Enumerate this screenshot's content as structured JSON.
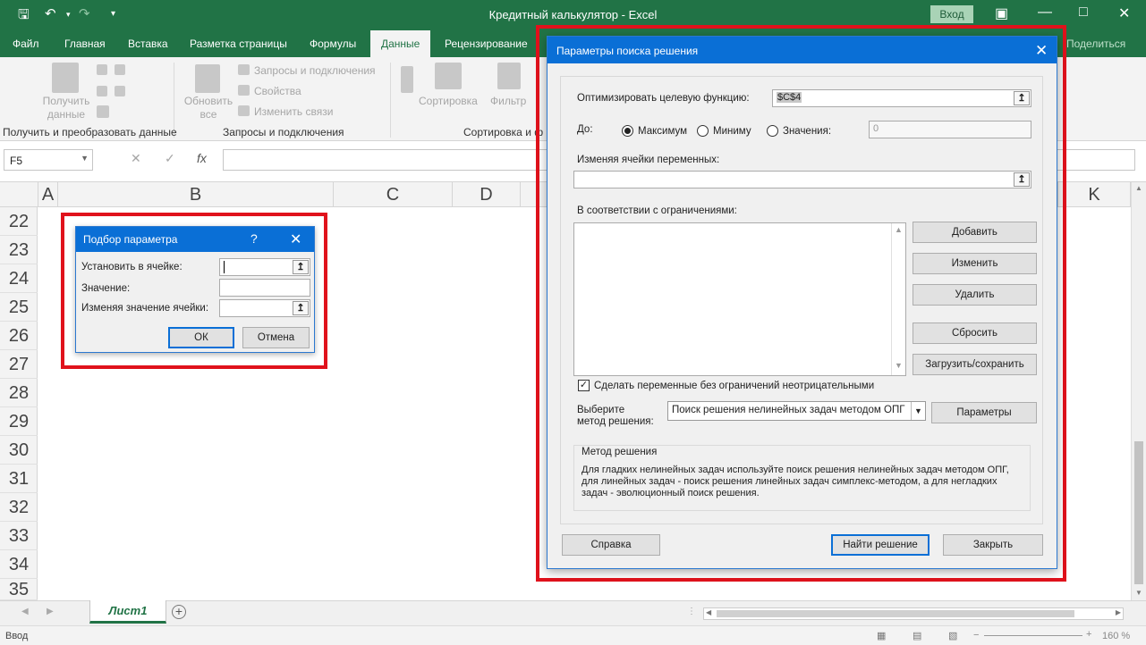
{
  "window": {
    "title": "Кредитный калькулятор  -  Excel",
    "login": "Вход"
  },
  "tabs": [
    "Файл",
    "Главная",
    "Вставка",
    "Разметка страницы",
    "Формулы",
    "Данные",
    "Рецензирование"
  ],
  "active_tab": "Данные",
  "share": "Поделиться",
  "ribbon": {
    "get_data": "Получить данные",
    "refresh": "Обновить все",
    "queries": "Запросы и подключения",
    "properties": "Свойства",
    "edit_links": "Изменить связи",
    "sort": "Сортировка",
    "filter": "Фильтр",
    "group_get": "Получить и преобразовать данные",
    "group_queries": "Запросы и подключения",
    "group_sort": "Сортировка и ф"
  },
  "formula_bar": {
    "name_box": "F5",
    "fx": "fx"
  },
  "columns": [
    "A",
    "B",
    "C",
    "D",
    "K"
  ],
  "rows": [
    "22",
    "23",
    "24",
    "25",
    "26",
    "27",
    "28",
    "29",
    "30",
    "31",
    "32",
    "33",
    "34",
    "35"
  ],
  "sheet": {
    "name": "Лист1"
  },
  "status": {
    "mode": "Ввод",
    "zoom": "160 %"
  },
  "goal_seek": {
    "title": "Подбор параметра",
    "help": "?",
    "set_cell_label": "Установить в ячейке:",
    "value_label": "Значение:",
    "changing_label": "Изменяя значение ячейки:",
    "ok": "ОК",
    "cancel": "Отмена"
  },
  "solver": {
    "title": "Параметры поиска решения",
    "objective_label": "Оптимизировать целевую функцию:",
    "objective_value": "$C$4",
    "to_label": "До:",
    "max": "Максимум",
    "min": "Миниму",
    "value_of": "Значения:",
    "value_of_input": "0",
    "changing_label": "Изменяя ячейки переменных:",
    "constraints_label": "В соответствии с ограничениями:",
    "add": "Добавить",
    "change": "Изменить",
    "delete": "Удалить",
    "reset": "Сбросить",
    "load_save": "Загрузить/сохранить",
    "nonneg": "Сделать переменные без ограничений неотрицательными",
    "method_label_1": "Выберите",
    "method_label_2": "метод решения:",
    "method_value": "Поиск решения нелинейных задач методом ОПГ",
    "options": "Параметры",
    "method_box_title": "Метод решения",
    "method_desc": "Для гладких нелинейных задач используйте поиск решения нелинейных задач методом ОПГ, для линейных задач - поиск решения линейных задач симплекс-методом, а для негладких задач - эволюционный поиск решения.",
    "help": "Справка",
    "solve": "Найти решение",
    "close": "Закрыть"
  },
  "colors": {
    "excel_green": "#217346",
    "dialog_blue": "#0a6fd6",
    "highlight_red": "#e0121c"
  }
}
